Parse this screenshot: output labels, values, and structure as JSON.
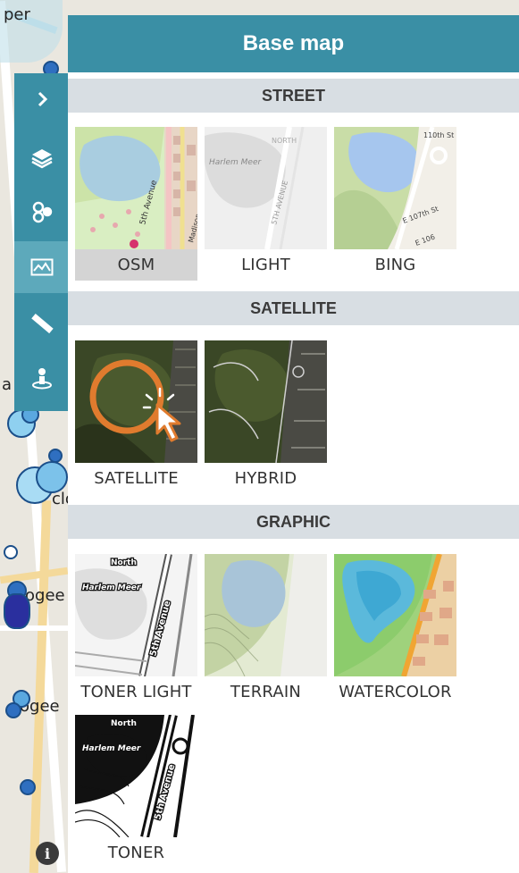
{
  "panel": {
    "title": "Base map"
  },
  "sections": [
    {
      "title": "STREET",
      "tiles": [
        {
          "label": "OSM",
          "selected": true
        },
        {
          "label": "LIGHT",
          "selected": false
        },
        {
          "label": "BING",
          "selected": false
        }
      ]
    },
    {
      "title": "SATELLITE",
      "tiles": [
        {
          "label": "SATELLITE",
          "selected": false
        },
        {
          "label": "HYBRID",
          "selected": false
        }
      ]
    },
    {
      "title": "GRAPHIC",
      "tiles": [
        {
          "label": "TONER LIGHT",
          "selected": false
        },
        {
          "label": "TERRAIN",
          "selected": false
        },
        {
          "label": "WATERCOLOR",
          "selected": false
        },
        {
          "label": "TONER",
          "selected": false
        }
      ]
    }
  ],
  "thumb_text": {
    "harlem_meer": "Harlem Meer",
    "fifth_avenue": "5th Avenue",
    "fifth_ave_caps": "5TH AVENUE",
    "madison": "Madison",
    "north": "NORTH",
    "e110": "110th St",
    "e107": "E 107th St",
    "e106": "E 106",
    "north_lower": "North"
  },
  "map_labels": {
    "top_left": "per",
    "mid_left": "a",
    "clo": "clo",
    "ogee": "ogee",
    "ogee2": "ogee"
  },
  "toolbar": {
    "items": [
      "chevron-right",
      "layers",
      "share-nodes",
      "basemap",
      "ruler",
      "pin-person"
    ],
    "active": "basemap"
  },
  "colors": {
    "teal": "#3a8fa5",
    "teal_light": "#5da9bb",
    "section_bg": "#d8dee3",
    "cursor_ring": "#e07b2e"
  }
}
